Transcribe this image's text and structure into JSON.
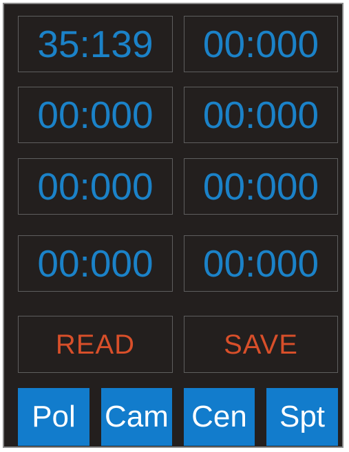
{
  "colors": {
    "background": "#231f1e",
    "timer_text": "#1b82c8",
    "action_text": "#d84f2a",
    "tab_background": "#127ccc",
    "tab_text": "#ffffff",
    "box_border": "#5f5f5f"
  },
  "timers": [
    {
      "value": "35:139"
    },
    {
      "value": "00:000"
    },
    {
      "value": "00:000"
    },
    {
      "value": "00:000"
    },
    {
      "value": "00:000"
    },
    {
      "value": "00:000"
    },
    {
      "value": "00:000"
    },
    {
      "value": "00:000"
    }
  ],
  "actions": {
    "read_label": "READ",
    "save_label": "SAVE"
  },
  "tabs": [
    {
      "label": "Pol"
    },
    {
      "label": "Cam"
    },
    {
      "label": "Cen"
    },
    {
      "label": "Spt"
    }
  ]
}
